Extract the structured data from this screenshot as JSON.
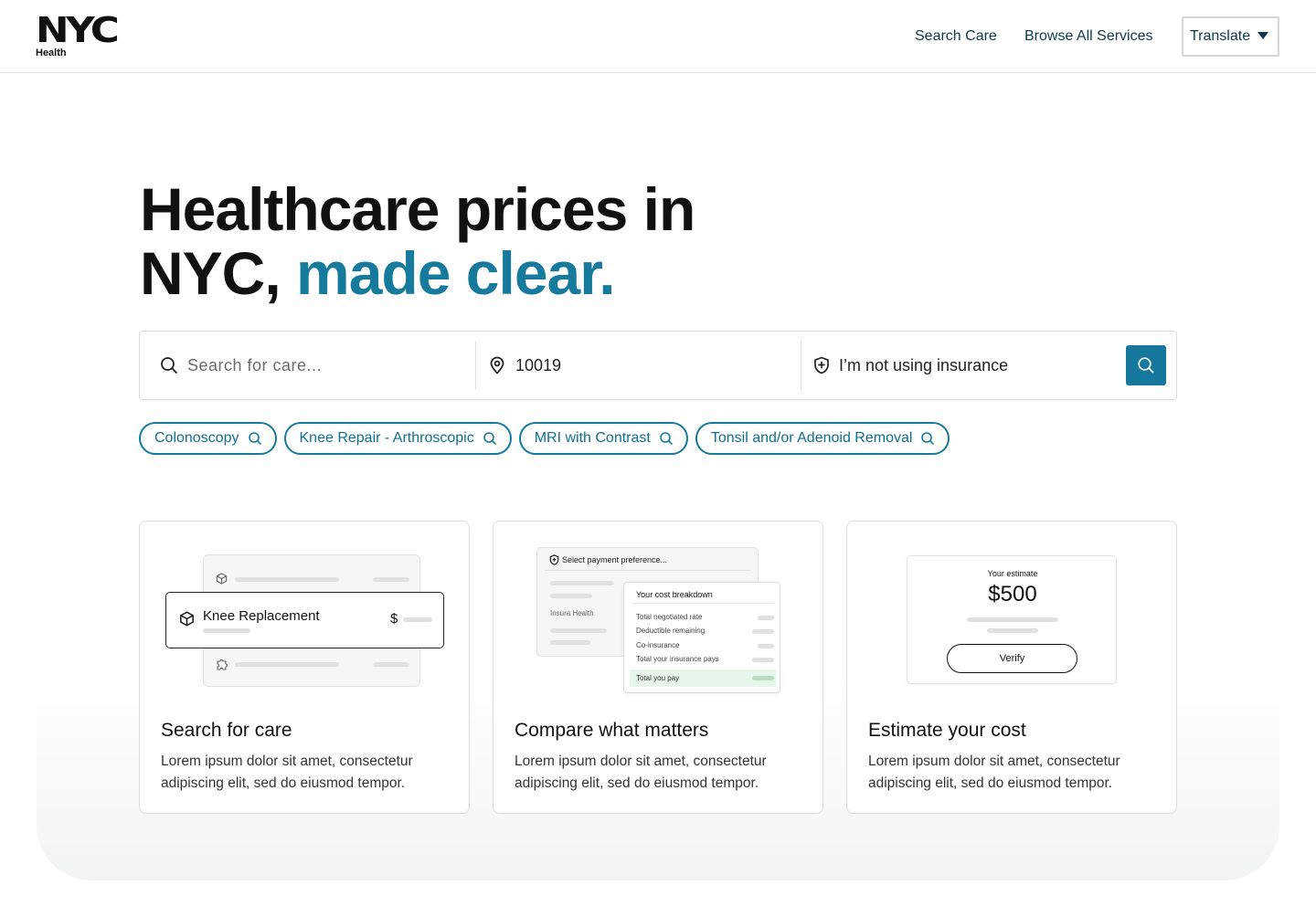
{
  "header": {
    "logo_mark": "NYC",
    "logo_sub": "Health",
    "nav": [
      "Search Care",
      "Browse All Services"
    ],
    "translate_label": "Translate"
  },
  "hero": {
    "title_line1": "Healthcare prices in",
    "title_line2_plain": "NYC, ",
    "title_line2_accent": "made clear."
  },
  "search": {
    "care_placeholder": "Search for care...",
    "zip_value": "10019",
    "insurance_text": "I’m not using insurance"
  },
  "chips": [
    "Colonoscopy",
    "Knee Repair - Arthroscopic",
    "MRI with Contrast",
    "Tonsil and/or Adenoid Removal"
  ],
  "cards": [
    {
      "title": "Search for care",
      "desc": "Lorem ipsum dolor sit amet, consectetur adipiscing elit, sed do eiusmod tempor.",
      "illustration": {
        "item_label": "Knee Replacement",
        "currency": "$"
      }
    },
    {
      "title": "Compare what matters",
      "desc": "Lorem ipsum dolor sit amet, consectetur adipiscing elit, sed do eiusmod tempor.",
      "illustration": {
        "back_title": "Select payment preference...",
        "back_item": "Insura Health",
        "front_title": "Your cost breakdown",
        "rows": [
          "Total negotiated rate",
          "Deductible remaining",
          "Co-insurance",
          "Total your insurance pays"
        ],
        "total_label": "Total you pay"
      }
    },
    {
      "title": "Estimate your cost",
      "desc": "Lorem ipsum dolor sit amet, consectetur adipiscing elit, sed do eiusmod tempor.",
      "illustration": {
        "label": "Your estimate",
        "amount": "$500",
        "button": "Verify"
      }
    }
  ],
  "colors": {
    "accent": "#157a9c",
    "button": "#16789c",
    "nav_text": "#0d3a4a",
    "total_highlight": "#e6f6ea"
  }
}
